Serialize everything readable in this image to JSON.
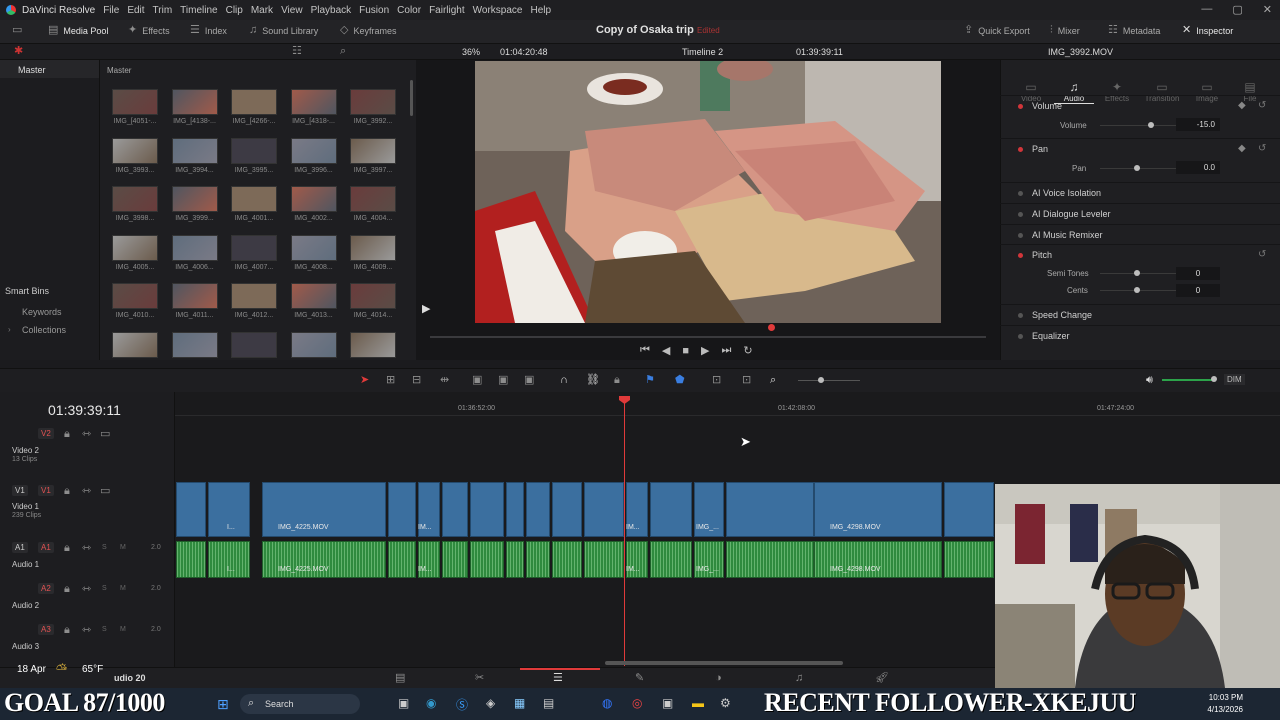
{
  "titlebar": {
    "app": "DaVinci Resolve",
    "menu": [
      "File",
      "Edit",
      "Trim",
      "Timeline",
      "Clip",
      "Mark",
      "View",
      "Playback",
      "Fusion",
      "Color",
      "Fairlight",
      "Workspace",
      "Help"
    ]
  },
  "toolbar": {
    "media_pool": "Media Pool",
    "effects": "Effects",
    "index": "Index",
    "sound_library": "Sound Library",
    "keyframes": "Keyframes",
    "project_title": "Copy of Osaka trip",
    "project_status": "Edited",
    "quick_export": "Quick Export",
    "mixer": "Mixer",
    "metadata": "Metadata",
    "inspector": "Inspector"
  },
  "subbar": {
    "zoom": "36%",
    "source_tc": "01:04:20:48",
    "timeline_name": "Timeline 2",
    "record_tc": "01:39:39:11",
    "clip_name": "IMG_3992.MOV"
  },
  "media_pool": {
    "master_left": "Master",
    "master_right": "Master",
    "smart_bins": "Smart Bins",
    "keywords": "Keywords",
    "collections": "Collections",
    "thumbs": [
      "IMG_[4051-...",
      "IMG_[4138-...",
      "IMG_[4266-...",
      "IMG_[4318-...",
      "IMG_3992...",
      "IMG_3993...",
      "IMG_3994...",
      "IMG_3995...",
      "IMG_3996...",
      "IMG_3997...",
      "IMG_3998...",
      "IMG_3999...",
      "IMG_4001...",
      "IMG_4002...",
      "IMG_4004...",
      "IMG_4005...",
      "IMG_4006...",
      "IMG_4007...",
      "IMG_4008...",
      "IMG_4009...",
      "IMG_4010...",
      "IMG_4011...",
      "IMG_4012...",
      "IMG_4013...",
      "IMG_4014...",
      "",
      "",
      "",
      "",
      ""
    ]
  },
  "inspector": {
    "tabs": [
      "Video",
      "Audio",
      "Effects",
      "Transition",
      "Image",
      "File"
    ],
    "volume_section": "Volume",
    "volume_label": "Volume",
    "volume_value": "-15.0",
    "pan_section": "Pan",
    "pan_label": "Pan",
    "pan_value": "0.0",
    "ai_voice": "AI Voice Isolation",
    "ai_dialogue": "AI Dialogue Leveler",
    "ai_music": "AI Music Remixer",
    "pitch": "Pitch",
    "semitones": "Semi Tones",
    "semitones_value": "0",
    "cents": "Cents",
    "cents_value": "0",
    "speed_change": "Speed Change",
    "equalizer": "Equalizer"
  },
  "timeline": {
    "timecode": "01:39:39:11",
    "ruler": [
      "01:36:52:00",
      "01:42:08:00",
      "01:47:24:00"
    ],
    "tracks": {
      "v2": "V2",
      "video2": "Video 2",
      "video2_clips": "13 Clips",
      "v1a": "V1",
      "v1b": "V1",
      "video1": "Video 1",
      "video1_clips": "239 Clips",
      "a1a": "A1",
      "a1b": "A1",
      "audio1": "Audio 1",
      "a2": "A2",
      "audio2": "Audio 2",
      "a3": "A3",
      "audio3": "Audio 3",
      "level": "2.0",
      "solo": "S",
      "mute": "M"
    },
    "clips": {
      "c1": "I...",
      "c2": "IMG_4225.MOV",
      "c3": "IM...",
      "c4": "IM...",
      "c5": "IMG_...",
      "c6": "IMG_4298.MOV"
    },
    "dim": "DIM"
  },
  "overlays": {
    "weather_date": "18 Apr",
    "weather_temp": "65°F",
    "audio20": "udio 20",
    "goal": "GOAL 87/1000",
    "follower": "RECENT FOLLOWER-XKEJUU"
  },
  "taskbar": {
    "search": "Search",
    "time": "10:03 PM",
    "date": "4/13/2026"
  }
}
